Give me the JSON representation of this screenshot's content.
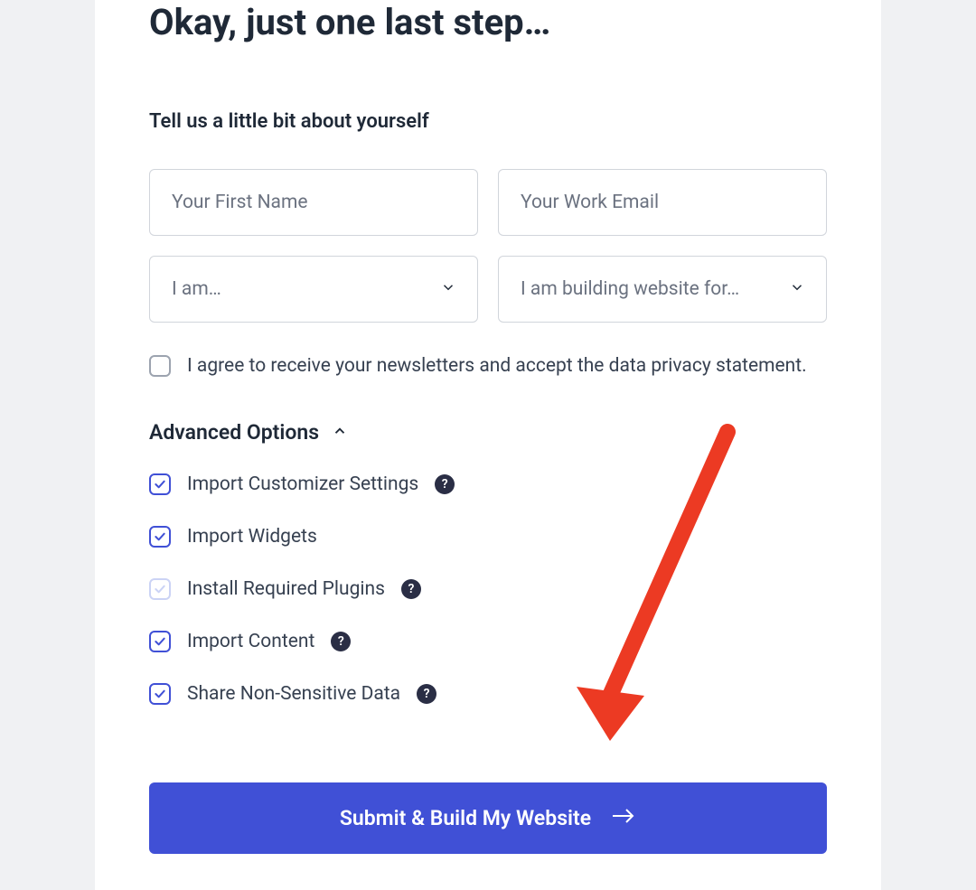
{
  "title": "Okay, just one last step…",
  "subtitle": "Tell us a little bit about yourself",
  "fields": {
    "first_name_placeholder": "Your First Name",
    "email_placeholder": "Your Work Email",
    "i_am_placeholder": "I am…",
    "building_for_placeholder": "I am building website for…"
  },
  "consent_text": "I agree to receive your newsletters and accept the data privacy statement.",
  "advanced": {
    "title": "Advanced Options",
    "options": [
      {
        "label": "Import Customizer Settings",
        "checked": true,
        "help": true
      },
      {
        "label": "Import Widgets",
        "checked": true,
        "help": false
      },
      {
        "label": "Install Required Plugins",
        "checked": true,
        "light": true,
        "help": true
      },
      {
        "label": "Import Content",
        "checked": true,
        "help": true
      },
      {
        "label": "Share Non-Sensitive Data",
        "checked": true,
        "help": true
      }
    ]
  },
  "submit_label": "Submit & Build My Website"
}
